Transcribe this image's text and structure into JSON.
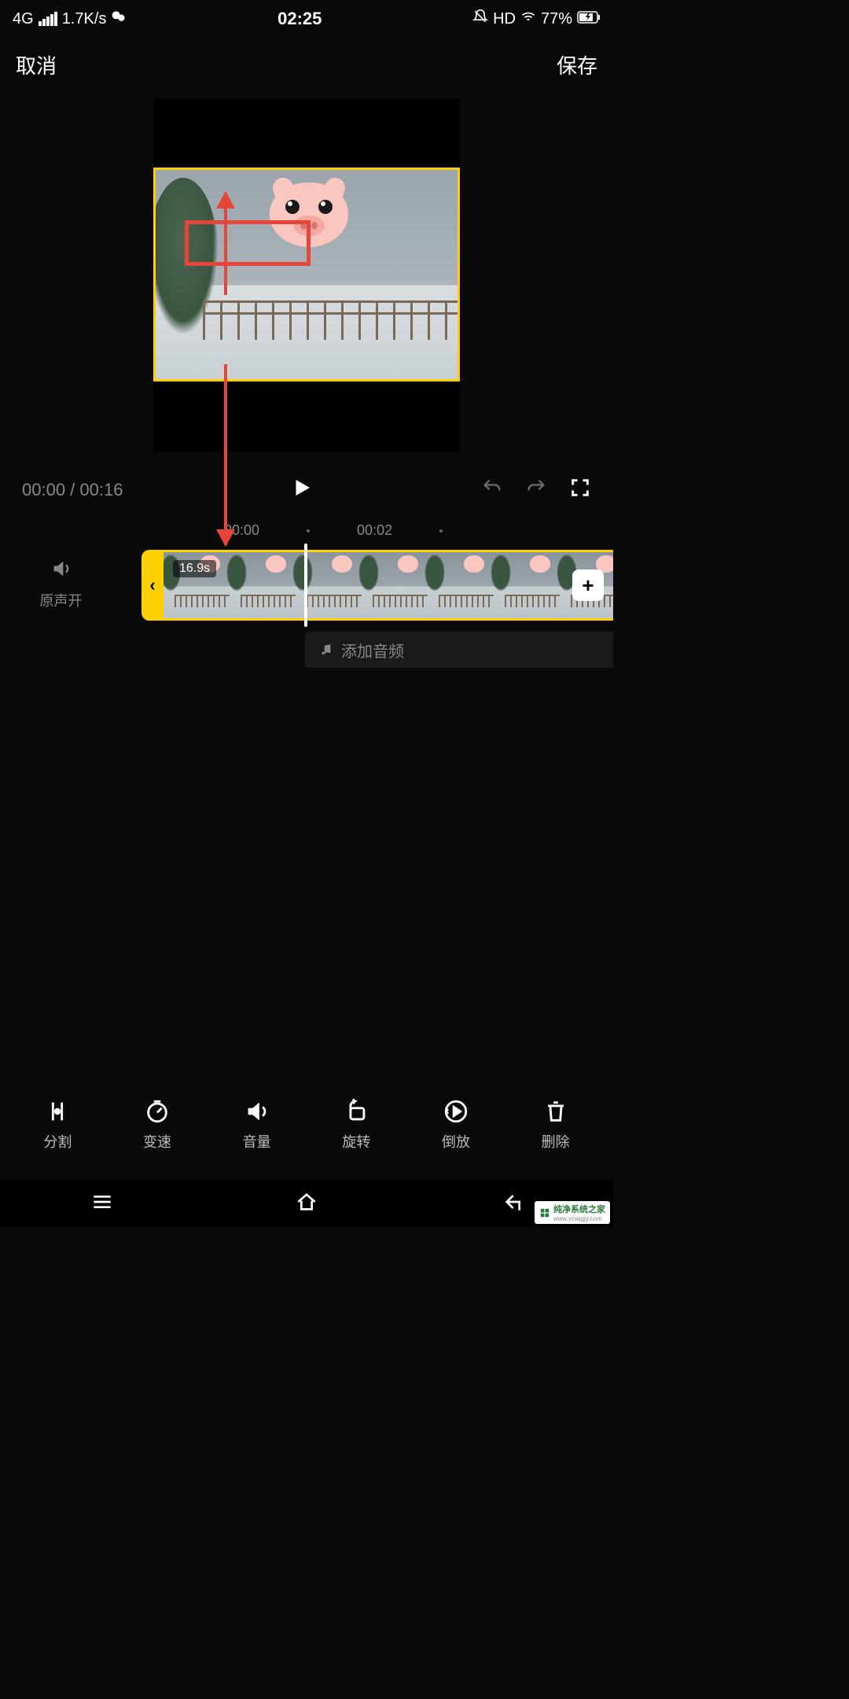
{
  "status": {
    "network": "4G",
    "speed": "1.7K/s",
    "time": "02:25",
    "hd": "HD",
    "battery": "77%"
  },
  "header": {
    "cancel": "取消",
    "save": "保存"
  },
  "playback": {
    "current": "00:00",
    "separator": " / ",
    "total": "00:16"
  },
  "ruler": {
    "t0": "00:00",
    "t1": "00:02"
  },
  "timeline": {
    "sound_label": "原声开",
    "clip_duration": "16.9s",
    "add_audio": "添加音频"
  },
  "tools": {
    "split": "分割",
    "speed": "变速",
    "volume": "音量",
    "rotate": "旋转",
    "reverse": "倒放",
    "delete": "删除"
  },
  "watermark": {
    "text": "纯净系统之家",
    "url": "www.ycwjgjy.com"
  },
  "colors": {
    "accent": "#ffd000",
    "annotation": "#e8453a"
  }
}
